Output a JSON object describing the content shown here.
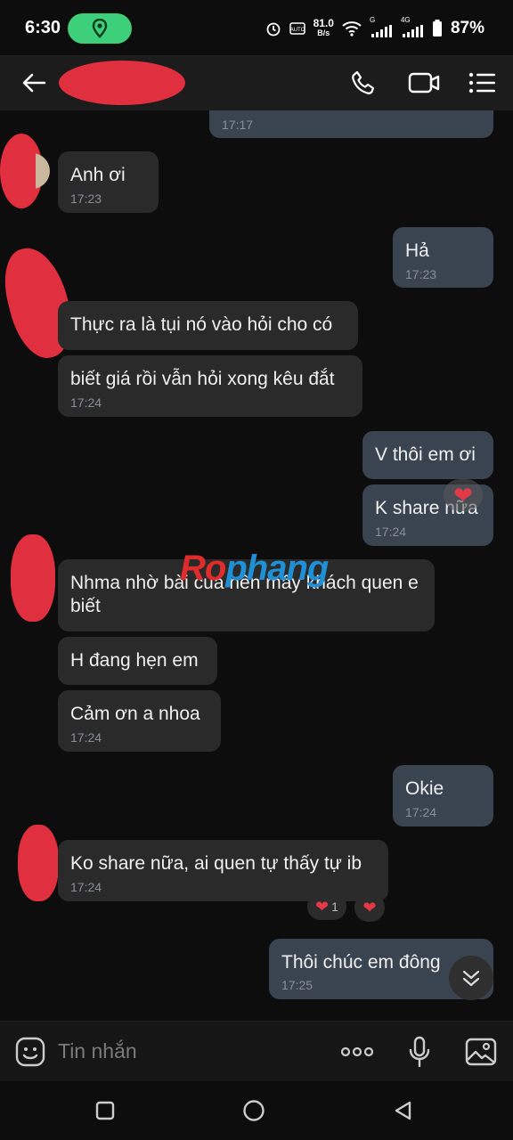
{
  "status_bar": {
    "time": "6:30",
    "speed_value": "81.0",
    "speed_unit": "B/s",
    "net_left": "G",
    "net_right": "4G",
    "battery": "87%"
  },
  "header": {
    "icons": [
      "back-arrow-icon",
      "phone-icon",
      "video-icon",
      "menu-icon"
    ]
  },
  "messages": [
    {
      "side": "out",
      "text": "",
      "time": "17:17"
    },
    {
      "side": "in",
      "text": "Anh ơi",
      "time": "17:23"
    },
    {
      "side": "out",
      "text": "Hả",
      "time": "17:23"
    },
    {
      "side": "in",
      "text": "Thực ra là tụi nó vào hỏi cho có",
      "time": ""
    },
    {
      "side": "in",
      "text": "biết giá rồi vẫn hỏi xong kêu đắt",
      "time": "17:24"
    },
    {
      "side": "out",
      "text": "V thôi em ơi",
      "time": ""
    },
    {
      "side": "out",
      "text": "K share nữa",
      "time": "17:24"
    },
    {
      "side": "in",
      "text": "Nhma nhờ bài của nên mấy khách quen e biết",
      "time": ""
    },
    {
      "side": "in",
      "text": "H đang hẹn em",
      "time": ""
    },
    {
      "side": "in",
      "text": "Cảm ơn a nhoa",
      "time": "17:24"
    },
    {
      "side": "out",
      "text": "Okie",
      "time": "17:24"
    },
    {
      "side": "in",
      "text": "Ko share nữa, ai quen tự thấy tự ib",
      "time": "17:24"
    },
    {
      "side": "out",
      "text": "Thôi chúc em đông",
      "time": "17:25"
    }
  ],
  "reactions": {
    "heart_count": "1"
  },
  "watermark": {
    "part1": "Ro",
    "part2": "phang"
  },
  "composer": {
    "placeholder": "Tin nhắn"
  },
  "colors": {
    "incoming_bubble": "#2a2a2a",
    "outgoing_bubble": "#3a4350",
    "background": "#0d0d0d",
    "location_pill": "#3ecf7a",
    "heart": "#e53847"
  }
}
